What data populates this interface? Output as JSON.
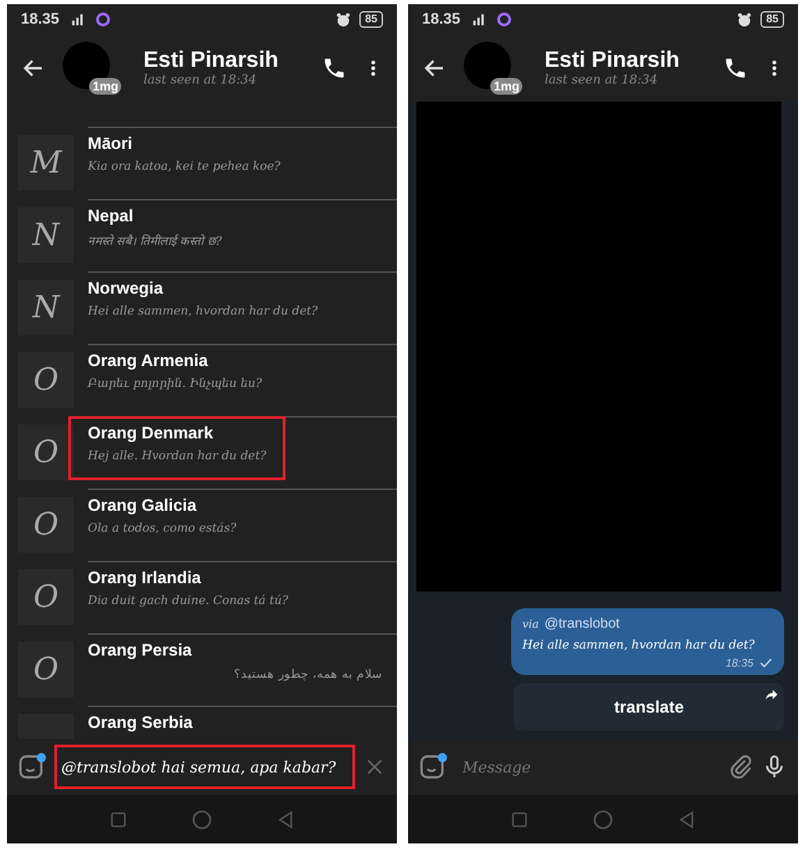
{
  "screens": [
    {
      "kind": "list",
      "status_bar": {
        "time": "18.35",
        "battery": "85"
      },
      "header": {
        "name": "Esti Pinarsih",
        "avatar_badge": "1mg",
        "status": "last seen at 18:34"
      },
      "items": [
        {
          "letter": "M",
          "title": "Māori",
          "subtitle": "Kia ora katoa, kei te pehea koe?",
          "rtl": false,
          "highlighted": false
        },
        {
          "letter": "N",
          "title": "Nepal",
          "subtitle": "नमस्ते सबै। तिमीलाई कस्तो छ?",
          "rtl": false,
          "highlighted": false
        },
        {
          "letter": "N",
          "title": "Norwegia",
          "subtitle": "Hei alle sammen, hvordan har du det?",
          "rtl": false,
          "highlighted": false
        },
        {
          "letter": "O",
          "title": "Orang Armenia",
          "subtitle": "Բարեւ բոլորին. Ինչպես ես?",
          "rtl": false,
          "highlighted": false
        },
        {
          "letter": "O",
          "title": "Orang Denmark",
          "subtitle": "Hej alle. Hvordan har du det?",
          "rtl": false,
          "highlighted": true
        },
        {
          "letter": "O",
          "title": "Orang Galicia",
          "subtitle": "Ola a todos, como estás?",
          "rtl": false,
          "highlighted": false
        },
        {
          "letter": "O",
          "title": "Orang Irlandia",
          "subtitle": "Dia duit gach duine. Conas tá tú?",
          "rtl": false,
          "highlighted": false
        },
        {
          "letter": "O",
          "title": "Orang Persia",
          "subtitle": "سلام به همه، چطور هستید؟",
          "rtl": true,
          "highlighted": false
        },
        {
          "title": "Orang Serbia",
          "highlighted": false
        }
      ],
      "input": {
        "value": "@translobot hai semua, apa kabar?",
        "highlighted": true
      }
    },
    {
      "kind": "chat",
      "status_bar": {
        "time": "18.35",
        "battery": "85"
      },
      "header": {
        "name": "Esti Pinarsih",
        "avatar_badge": "1mg",
        "status": "last seen at 18:34"
      },
      "message": {
        "via": "via",
        "bot": "@translobot",
        "text": "Hei alle sammen, hvordan har du det?",
        "time": "18:35"
      },
      "inline_button": "translate",
      "input": {
        "placeholder": "Message",
        "highlighted": false
      }
    }
  ]
}
